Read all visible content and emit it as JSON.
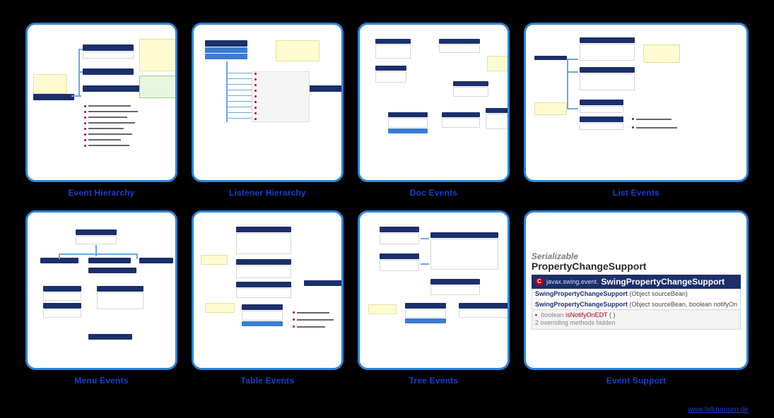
{
  "captions": [
    "Event Hierarchy",
    "Listener Hierarchy",
    "Doc Events",
    "List Events",
    "Menu Events",
    "Table Events",
    "Tree Events",
    "Event Support"
  ],
  "footer_link": "www.falkhausen.de",
  "event_support": {
    "superclass_interface": "Serializable",
    "superclass_name": "PropertyChangeSupport",
    "package": "javax.swing.event.",
    "class_name": "SwingPropertyChangeSupport",
    "constructors": [
      {
        "name": "SwingPropertyChangeSupport",
        "params": "(Object sourceBean)"
      },
      {
        "name": "SwingPropertyChangeSupport",
        "params": "(Object sourceBean, boolean notifyOn"
      }
    ],
    "method_return": "boolean",
    "method_name": "isNotifyOnEDT",
    "method_params": "( )",
    "hidden_note": "2 overriding methods hidden"
  }
}
